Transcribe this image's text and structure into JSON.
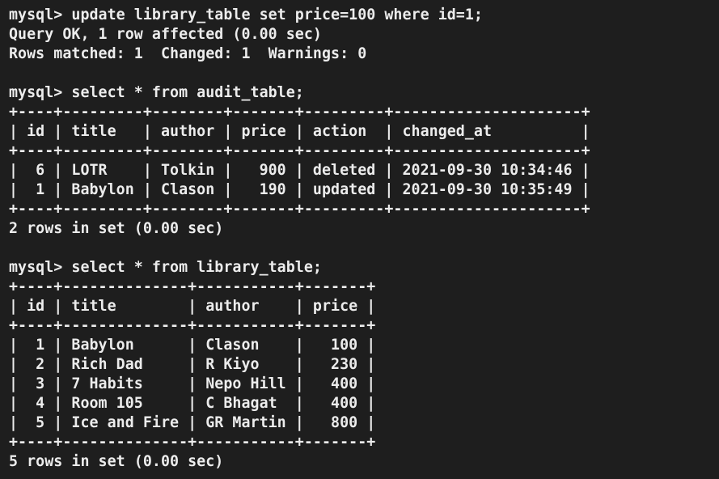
{
  "terminal": {
    "update_block": {
      "prompt_line": "mysql> update library_table set price=100 where id=1;",
      "status_line": "Query OK, 1 row affected (0.00 sec)",
      "info_line": "Rows matched: 1  Changed: 1  Warnings: 0"
    },
    "audit_query": {
      "prompt_line": "mysql> select * from audit_table;",
      "border": "+----+---------+--------+-------+---------+---------------------+",
      "header_row": "| id | title   | author | price | action  | changed_at          |",
      "columns": [
        "id",
        "title",
        "author",
        "price",
        "action",
        "changed_at"
      ],
      "rows": [
        [
          "6",
          "LOTR",
          "Tolkin",
          "900",
          "deleted",
          "2021-09-30 10:34:46"
        ],
        [
          "1",
          "Babylon",
          "Clason",
          "190",
          "updated",
          "2021-09-30 10:35:49"
        ]
      ],
      "row_lines": [
        "|  6 | LOTR    | Tolkin |   900 | deleted | 2021-09-30 10:34:46 |",
        "|  1 | Babylon | Clason |   190 | updated | 2021-09-30 10:35:49 |"
      ],
      "summary_line": "2 rows in set (0.00 sec)"
    },
    "library_query": {
      "prompt_line": "mysql> select * from library_table;",
      "border": "+----+--------------+-----------+-------+",
      "header_row": "| id | title        | author    | price |",
      "columns": [
        "id",
        "title",
        "author",
        "price"
      ],
      "rows": [
        [
          "1",
          "Babylon",
          "Clason",
          "100"
        ],
        [
          "2",
          "Rich Dad",
          "R Kiyo",
          "230"
        ],
        [
          "3",
          "7 Habits",
          "Nepo Hill",
          "400"
        ],
        [
          "4",
          "Room 105",
          "C Bhagat",
          "400"
        ],
        [
          "5",
          "Ice and Fire",
          "GR Martin",
          "800"
        ]
      ],
      "row_lines": [
        "|  1 | Babylon      | Clason    |   100 |",
        "|  2 | Rich Dad     | R Kiyo    |   230 |",
        "|  3 | 7 Habits     | Nepo Hill |   400 |",
        "|  4 | Room 105     | C Bhagat  |   400 |",
        "|  5 | Ice and Fire | GR Martin |   800 |"
      ],
      "summary_line": "5 rows in set (0.00 sec)"
    },
    "colors": {
      "background": "#1e1e1e",
      "text": "#ececec"
    }
  }
}
